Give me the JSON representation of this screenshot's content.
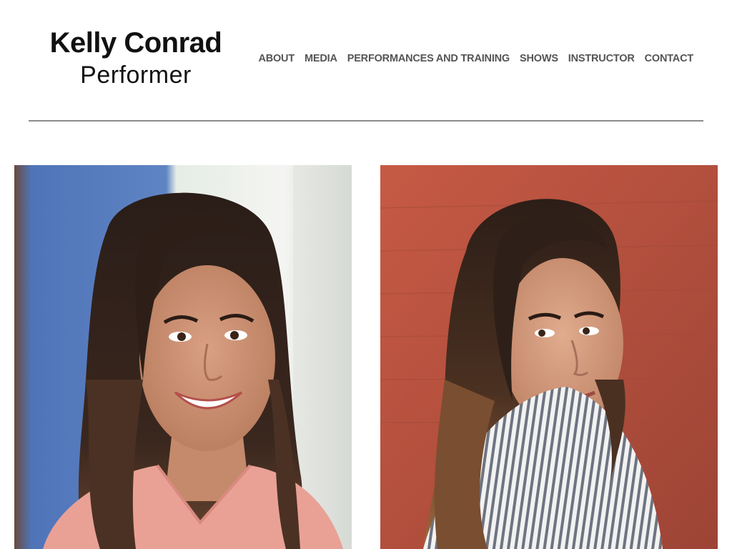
{
  "site": {
    "name": "Kelly Conrad",
    "role": "Performer"
  },
  "nav": {
    "items": [
      {
        "label": "ABOUT"
      },
      {
        "label": "MEDIA"
      },
      {
        "label": "PERFORMANCES AND TRAINING"
      },
      {
        "label": "SHOWS"
      },
      {
        "label": "INSTRUCTOR"
      },
      {
        "label": "CONTACT"
      }
    ]
  },
  "gallery": {
    "photos": [
      {
        "subject": "headshot-smiling-pink-top",
        "background": "blue-wall"
      },
      {
        "subject": "headshot-over-shoulder-striped-shirt",
        "background": "red-brick-wall"
      }
    ]
  },
  "colors": {
    "nav_text": "#555555",
    "brand_text": "#111111",
    "divider": "#8c8c8c",
    "pink_top": "#e9a195",
    "red_wall": "#b4503f",
    "blue_wall": "#5577b8"
  }
}
